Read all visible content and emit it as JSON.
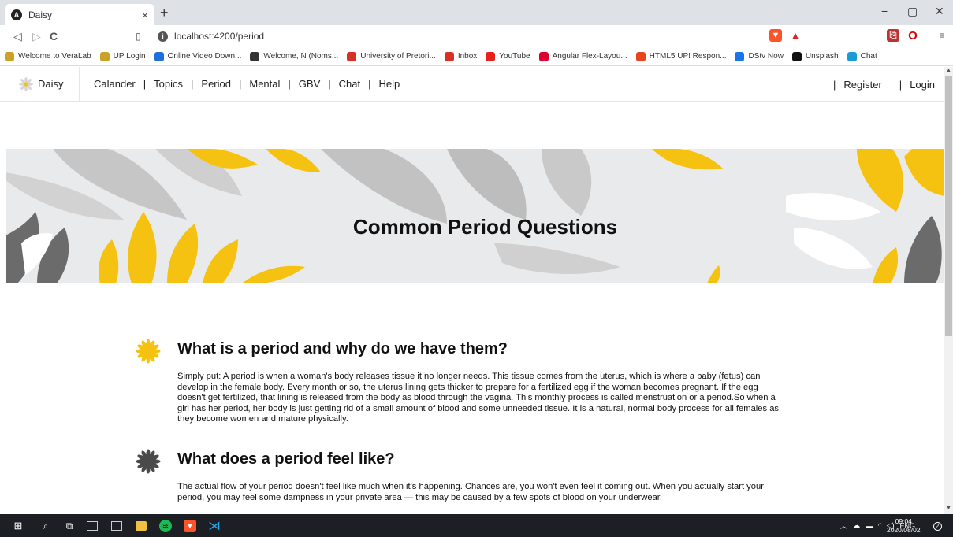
{
  "browser": {
    "tab_title": "Daisy",
    "tab_close": "×",
    "new_tab": "+",
    "url": "localhost:4200/period",
    "window_controls": {
      "minimize": "−",
      "maximize": "▢",
      "close": "✕"
    },
    "nav": {
      "back": "◁",
      "forward": "▷",
      "reload": "C"
    },
    "bookmarks": [
      {
        "label": "Welcome to VeraLab",
        "color": "#c9a227",
        "icon": "person-icon"
      },
      {
        "label": "UP Login",
        "color": "#c9a227",
        "icon": "person-icon"
      },
      {
        "label": "Online Video Down...",
        "color": "#1e6fd9",
        "icon": "download-icon"
      },
      {
        "label": "Welcome, N (Noms...",
        "color": "#333333",
        "icon": "mail-icon"
      },
      {
        "label": "University of Pretori...",
        "color": "#d93025",
        "icon": "gmail-icon"
      },
      {
        "label": "Inbox",
        "color": "#d93025",
        "icon": "gmail-icon"
      },
      {
        "label": "YouTube",
        "color": "#e62117",
        "icon": "youtube-icon"
      },
      {
        "label": "Angular Flex-Layou...",
        "color": "#dd0031",
        "icon": "angular-icon"
      },
      {
        "label": "HTML5 UP! Respon...",
        "color": "#e8431e",
        "icon": "html5up-icon"
      },
      {
        "label": "DStv Now",
        "color": "#1a73e8",
        "icon": "play-icon"
      },
      {
        "label": "Unsplash",
        "color": "#111111",
        "icon": "unsplash-icon"
      },
      {
        "label": "Chat",
        "color": "#1a9bd7",
        "icon": "chat-icon"
      }
    ]
  },
  "site": {
    "brand": "Daisy",
    "nav_links": [
      "Calander",
      "Topics",
      "Period",
      "Mental",
      "GBV",
      "Chat",
      "Help"
    ],
    "separator": "|",
    "register": "Register",
    "login": "Login"
  },
  "hero": {
    "title": "Common Period Questions"
  },
  "questions": [
    {
      "title": "What is a period and why do we have them?",
      "icon_color": "#f5c211",
      "body": "Simply put: A period is when a woman's body releases tissue it no longer needs. This tissue comes from the uterus, which is where a baby (fetus) can develop in the female body. Every month or so, the uterus lining gets thicker to prepare for a fertilized egg if the woman becomes pregnant. If the egg doesn't get fertilized, that lining is released from the body as blood through the vagina. This monthly process is called menstruation or a period.So when a girl has her period, her body is just getting rid of a small amount of blood and some unneeded tissue. It is a natural, normal body process for all females as they become women and mature physically."
    },
    {
      "title": "What does a period feel like?",
      "icon_color": "#4a4a4a",
      "body": "The actual flow of your period doesn't feel like much when it's happening. Chances are, you won't even feel it coming out. When you actually start your period, you may feel some dampness in your private area — this may be caused by a few spots of blood on your underwear."
    }
  ],
  "taskbar": {
    "tray_lang": "ENG",
    "time": "09:04",
    "date": "2020/08/02",
    "notifications": "2"
  },
  "colors": {
    "accent_yellow": "#f5c211",
    "petal_grey": "#c4c4c4",
    "petal_dark": "#6b6b6b"
  }
}
